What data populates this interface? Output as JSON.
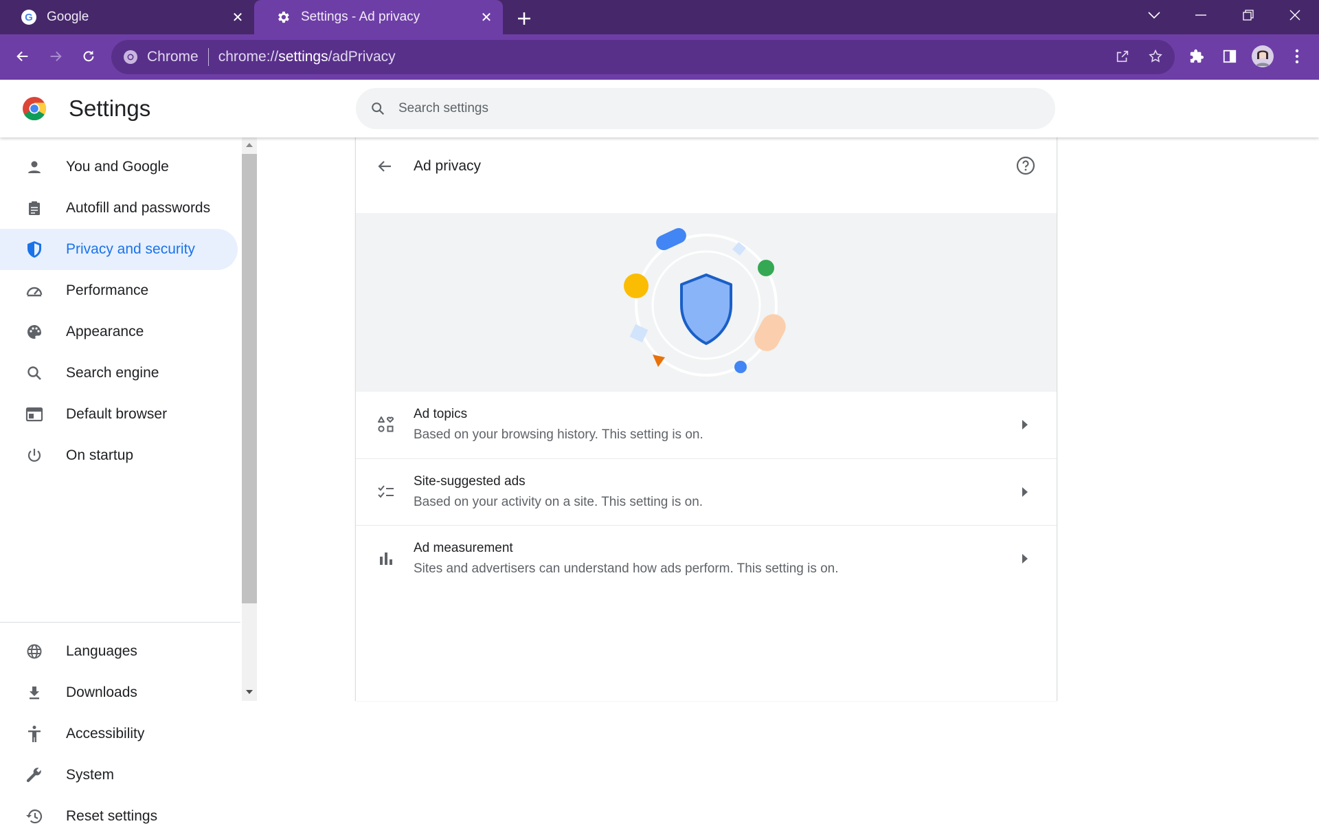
{
  "tabs": [
    {
      "title": "Google",
      "icon": "google-icon",
      "active": false
    },
    {
      "title": "Settings - Ad privacy",
      "icon": "gear-icon",
      "active": true
    }
  ],
  "omnibox": {
    "site_label": "Chrome",
    "url_prefix": "chrome://",
    "url_host": "settings",
    "url_path": "/adPrivacy"
  },
  "header": {
    "title": "Settings",
    "search_placeholder": "Search settings"
  },
  "sidebar": {
    "items": [
      {
        "label": "You and Google",
        "icon": "person-icon",
        "active": false
      },
      {
        "label": "Autofill and passwords",
        "icon": "clipboard-icon",
        "active": false
      },
      {
        "label": "Privacy and security",
        "icon": "shield-icon",
        "active": true
      },
      {
        "label": "Performance",
        "icon": "speedometer-icon",
        "active": false
      },
      {
        "label": "Appearance",
        "icon": "palette-icon",
        "active": false
      },
      {
        "label": "Search engine",
        "icon": "search-icon",
        "active": false
      },
      {
        "label": "Default browser",
        "icon": "browser-icon",
        "active": false
      },
      {
        "label": "On startup",
        "icon": "power-icon",
        "active": false
      },
      {
        "label": "Languages",
        "icon": "globe-icon",
        "active": false
      },
      {
        "label": "Downloads",
        "icon": "download-icon",
        "active": false
      },
      {
        "label": "Accessibility",
        "icon": "accessibility-icon",
        "active": false
      },
      {
        "label": "System",
        "icon": "wrench-icon",
        "active": false
      },
      {
        "label": "Reset settings",
        "icon": "history-icon",
        "active": false
      }
    ]
  },
  "page": {
    "title": "Ad privacy",
    "rows": [
      {
        "title": "Ad topics",
        "subtitle": "Based on your browsing history. This setting is on.",
        "icon": "topics-icon"
      },
      {
        "title": "Site-suggested ads",
        "subtitle": "Based on your activity on a site. This setting is on.",
        "icon": "checklist-icon"
      },
      {
        "title": "Ad measurement",
        "subtitle": "Sites and advertisers can understand how ads perform. This setting is on.",
        "icon": "bar-chart-icon"
      }
    ]
  },
  "colors": {
    "accent": "#1a73e8",
    "frame": "#46286a",
    "toolbar": "#6e3ea7",
    "active_nav_bg": "#e8f0fe"
  }
}
